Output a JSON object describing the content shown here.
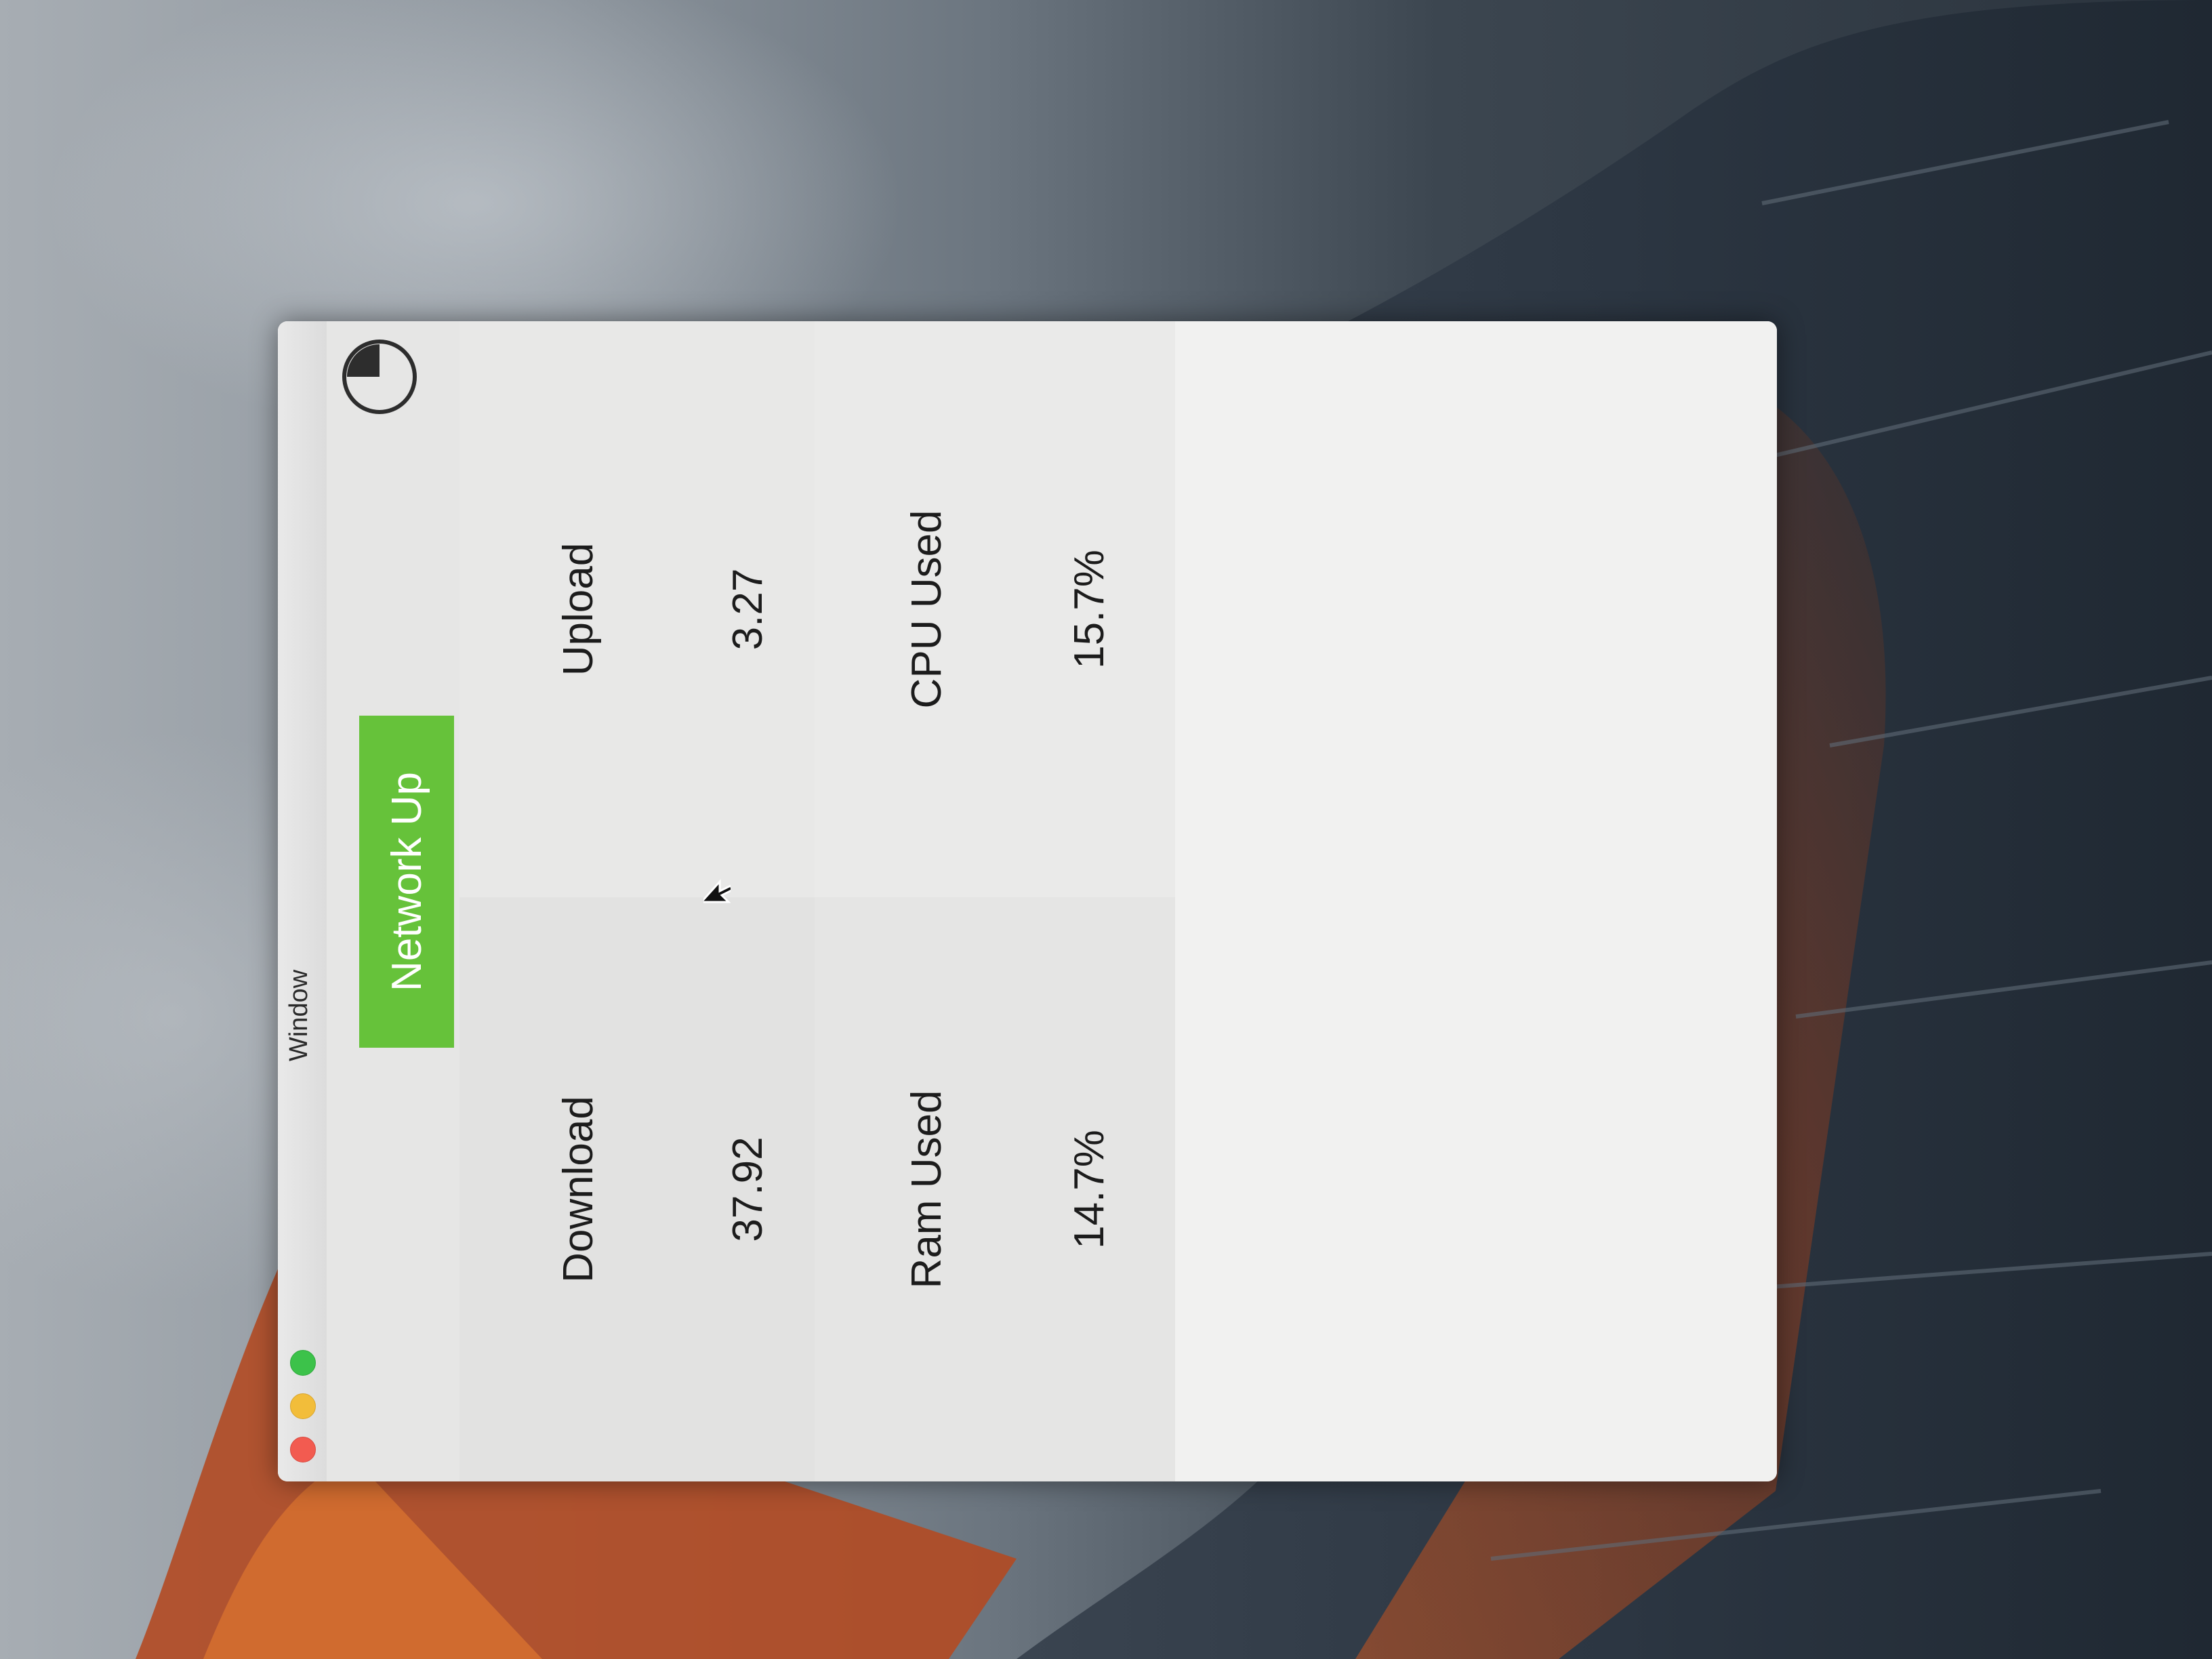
{
  "menubar": {
    "window_menu": "Window"
  },
  "status": {
    "label": "Network Up",
    "color": "#66c23a"
  },
  "icons": {
    "timer": "timer-icon",
    "cursor": "cursor-arrow-icon"
  },
  "window_controls": {
    "close_color": "#f25b50",
    "minimize_color": "#f2bd3a",
    "zoom_color": "#3cc24a"
  },
  "stats": {
    "download": {
      "label": "Download",
      "value": "37.92"
    },
    "upload": {
      "label": "Upload",
      "value": "3.27"
    },
    "ram": {
      "label": "Ram Used",
      "value": "14.7%"
    },
    "cpu": {
      "label": "CPU Used",
      "value": "15.7%"
    }
  }
}
